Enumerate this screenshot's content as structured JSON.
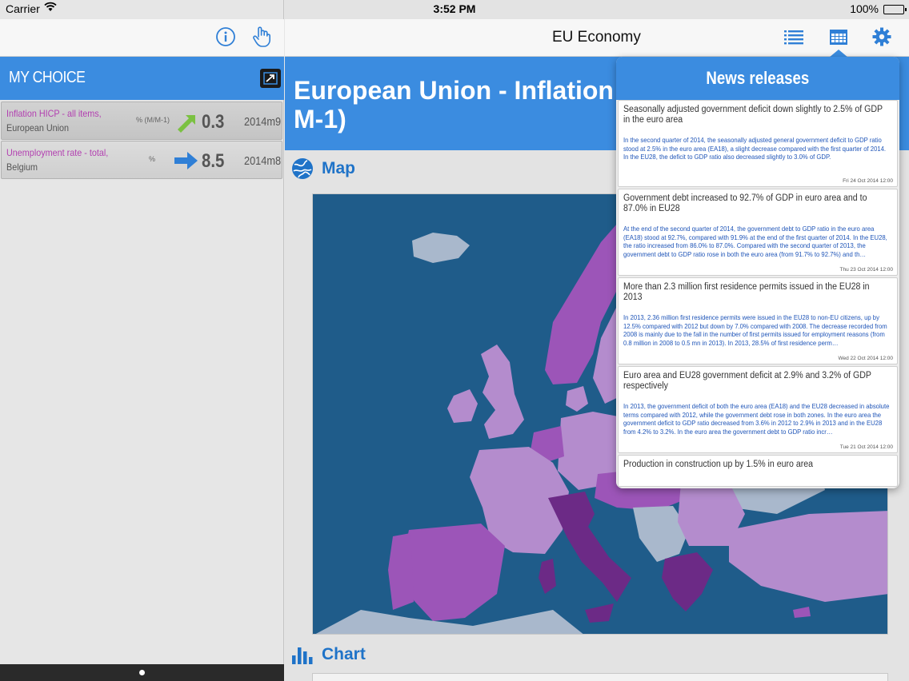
{
  "status_bar": {
    "carrier": "Carrier",
    "time": "3:52 PM",
    "battery": "100%",
    "battery_level": 1.0
  },
  "left_panel": {
    "header_title": "MY CHOICE",
    "indicators": [
      {
        "name": "Inflation HICP - all items,",
        "geo": "European Union",
        "unit": "% (M/M-1)",
        "trend": "up-right-arrow-icon",
        "trend_color": "#7bc142",
        "value": "0.3",
        "period": "2014m9"
      },
      {
        "name": "Unemployment rate - total,",
        "geo": "Belgium",
        "unit": "%",
        "trend": "right-arrow-icon",
        "trend_color": "#2f7fd6",
        "value": "8.5",
        "period": "2014m8"
      }
    ]
  },
  "main": {
    "app_title": "EU Economy",
    "page_title": "European Union - Inflation H\nM-1)",
    "sections": {
      "map_label": "Map",
      "chart_label": "Chart"
    }
  },
  "news_popover": {
    "title": "News releases",
    "items": [
      {
        "title": "Seasonally adjusted government deficit down slightly to 2.5% of GDP in the euro area",
        "body": "In the second quarter of 2014, the seasonally adjusted general government deficit to GDP ratio stood at 2.5% in the euro area (EA18), a slight decrease compared with the first quarter of 2014. In the EU28, the deficit to GDP ratio also decreased slightly to 3.0% of GDP.",
        "date": "Fri 24 Oct 2014 12:00"
      },
      {
        "title": "Government debt increased to 92.7% of GDP in euro area and to 87.0% in EU28",
        "body": "At the end of the second quarter of 2014, the government debt to GDP ratio in the euro area (EA18) stood at 92.7%, compared with 91.9% at the end of the first quarter of 2014. In the EU28, the ratio increased from 86.0% to 87.0%. Compared with the second quarter of 2013, the government debt to GDP ratio rose in both the euro area (from 91.7% to 92.7%) and th…",
        "date": "Thu 23 Oct 2014 12:00"
      },
      {
        "title": "More than 2.3 million first residence permits issued in the EU28 in 2013",
        "body": "In 2013, 2.36 million first residence permits were issued in the EU28 to non-EU citizens, up by 12.5% compared with 2012 but down by 7.0% compared with 2008. The decrease recorded from 2008 is mainly due to the fall in the number of first permits issued for employment reasons (from 0.8 million in 2008 to 0.5 mn in 2013). In 2013, 28.5% of first residence perm…",
        "date": "Wed 22 Oct 2014 12:00"
      },
      {
        "title": "Euro area and EU28 government deficit at 2.9% and 3.2% of GDP respectively",
        "body": "In 2013, the government deficit of both the euro area (EA18) and the EU28 decreased in absolute terms compared with 2012, while the government debt rose in both zones. In the euro area the government deficit to GDP ratio decreased from 3.6% in 2012 to 2.9% in 2013 and in the EU28 from 4.2% to 3.2%. In the euro area the government debt to GDP ratio incr…",
        "date": "Tue 21 Oct 2014 12:00"
      },
      {
        "title": "Production in construction up by 1.5% in euro area",
        "body": "",
        "date": ""
      }
    ]
  },
  "colors": {
    "accent_blue": "#3b8ce0",
    "sea": "#1f5c8a",
    "purple_light": "#b48ccd",
    "purple_mid": "#9c55b8",
    "purple_dark": "#6c2a86"
  }
}
